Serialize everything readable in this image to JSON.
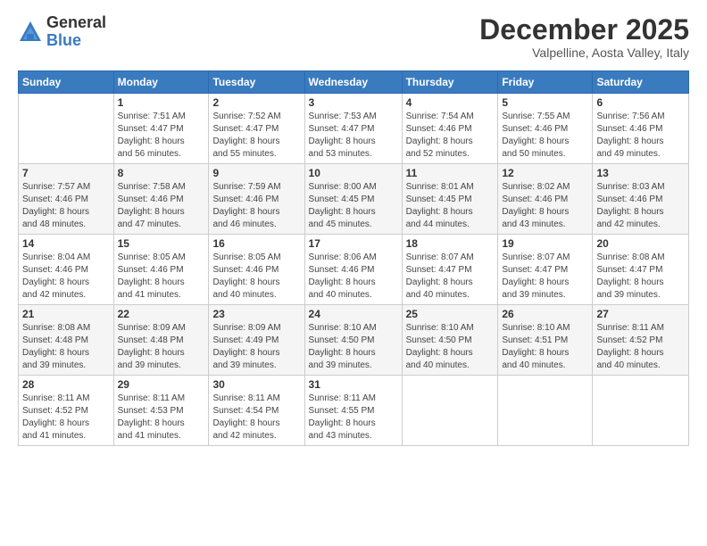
{
  "logo": {
    "general": "General",
    "blue": "Blue"
  },
  "title": "December 2025",
  "location": "Valpelline, Aosta Valley, Italy",
  "weekdays": [
    "Sunday",
    "Monday",
    "Tuesday",
    "Wednesday",
    "Thursday",
    "Friday",
    "Saturday"
  ],
  "weeks": [
    [
      {
        "day": "",
        "info": ""
      },
      {
        "day": "1",
        "info": "Sunrise: 7:51 AM\nSunset: 4:47 PM\nDaylight: 8 hours\nand 56 minutes."
      },
      {
        "day": "2",
        "info": "Sunrise: 7:52 AM\nSunset: 4:47 PM\nDaylight: 8 hours\nand 55 minutes."
      },
      {
        "day": "3",
        "info": "Sunrise: 7:53 AM\nSunset: 4:47 PM\nDaylight: 8 hours\nand 53 minutes."
      },
      {
        "day": "4",
        "info": "Sunrise: 7:54 AM\nSunset: 4:46 PM\nDaylight: 8 hours\nand 52 minutes."
      },
      {
        "day": "5",
        "info": "Sunrise: 7:55 AM\nSunset: 4:46 PM\nDaylight: 8 hours\nand 50 minutes."
      },
      {
        "day": "6",
        "info": "Sunrise: 7:56 AM\nSunset: 4:46 PM\nDaylight: 8 hours\nand 49 minutes."
      }
    ],
    [
      {
        "day": "7",
        "info": "Sunrise: 7:57 AM\nSunset: 4:46 PM\nDaylight: 8 hours\nand 48 minutes."
      },
      {
        "day": "8",
        "info": "Sunrise: 7:58 AM\nSunset: 4:46 PM\nDaylight: 8 hours\nand 47 minutes."
      },
      {
        "day": "9",
        "info": "Sunrise: 7:59 AM\nSunset: 4:46 PM\nDaylight: 8 hours\nand 46 minutes."
      },
      {
        "day": "10",
        "info": "Sunrise: 8:00 AM\nSunset: 4:45 PM\nDaylight: 8 hours\nand 45 minutes."
      },
      {
        "day": "11",
        "info": "Sunrise: 8:01 AM\nSunset: 4:45 PM\nDaylight: 8 hours\nand 44 minutes."
      },
      {
        "day": "12",
        "info": "Sunrise: 8:02 AM\nSunset: 4:46 PM\nDaylight: 8 hours\nand 43 minutes."
      },
      {
        "day": "13",
        "info": "Sunrise: 8:03 AM\nSunset: 4:46 PM\nDaylight: 8 hours\nand 42 minutes."
      }
    ],
    [
      {
        "day": "14",
        "info": "Sunrise: 8:04 AM\nSunset: 4:46 PM\nDaylight: 8 hours\nand 42 minutes."
      },
      {
        "day": "15",
        "info": "Sunrise: 8:05 AM\nSunset: 4:46 PM\nDaylight: 8 hours\nand 41 minutes."
      },
      {
        "day": "16",
        "info": "Sunrise: 8:05 AM\nSunset: 4:46 PM\nDaylight: 8 hours\nand 40 minutes."
      },
      {
        "day": "17",
        "info": "Sunrise: 8:06 AM\nSunset: 4:46 PM\nDaylight: 8 hours\nand 40 minutes."
      },
      {
        "day": "18",
        "info": "Sunrise: 8:07 AM\nSunset: 4:47 PM\nDaylight: 8 hours\nand 40 minutes."
      },
      {
        "day": "19",
        "info": "Sunrise: 8:07 AM\nSunset: 4:47 PM\nDaylight: 8 hours\nand 39 minutes."
      },
      {
        "day": "20",
        "info": "Sunrise: 8:08 AM\nSunset: 4:47 PM\nDaylight: 8 hours\nand 39 minutes."
      }
    ],
    [
      {
        "day": "21",
        "info": "Sunrise: 8:08 AM\nSunset: 4:48 PM\nDaylight: 8 hours\nand 39 minutes."
      },
      {
        "day": "22",
        "info": "Sunrise: 8:09 AM\nSunset: 4:48 PM\nDaylight: 8 hours\nand 39 minutes."
      },
      {
        "day": "23",
        "info": "Sunrise: 8:09 AM\nSunset: 4:49 PM\nDaylight: 8 hours\nand 39 minutes."
      },
      {
        "day": "24",
        "info": "Sunrise: 8:10 AM\nSunset: 4:50 PM\nDaylight: 8 hours\nand 39 minutes."
      },
      {
        "day": "25",
        "info": "Sunrise: 8:10 AM\nSunset: 4:50 PM\nDaylight: 8 hours\nand 40 minutes."
      },
      {
        "day": "26",
        "info": "Sunrise: 8:10 AM\nSunset: 4:51 PM\nDaylight: 8 hours\nand 40 minutes."
      },
      {
        "day": "27",
        "info": "Sunrise: 8:11 AM\nSunset: 4:52 PM\nDaylight: 8 hours\nand 40 minutes."
      }
    ],
    [
      {
        "day": "28",
        "info": "Sunrise: 8:11 AM\nSunset: 4:52 PM\nDaylight: 8 hours\nand 41 minutes."
      },
      {
        "day": "29",
        "info": "Sunrise: 8:11 AM\nSunset: 4:53 PM\nDaylight: 8 hours\nand 41 minutes."
      },
      {
        "day": "30",
        "info": "Sunrise: 8:11 AM\nSunset: 4:54 PM\nDaylight: 8 hours\nand 42 minutes."
      },
      {
        "day": "31",
        "info": "Sunrise: 8:11 AM\nSunset: 4:55 PM\nDaylight: 8 hours\nand 43 minutes."
      },
      {
        "day": "",
        "info": ""
      },
      {
        "day": "",
        "info": ""
      },
      {
        "day": "",
        "info": ""
      }
    ]
  ]
}
